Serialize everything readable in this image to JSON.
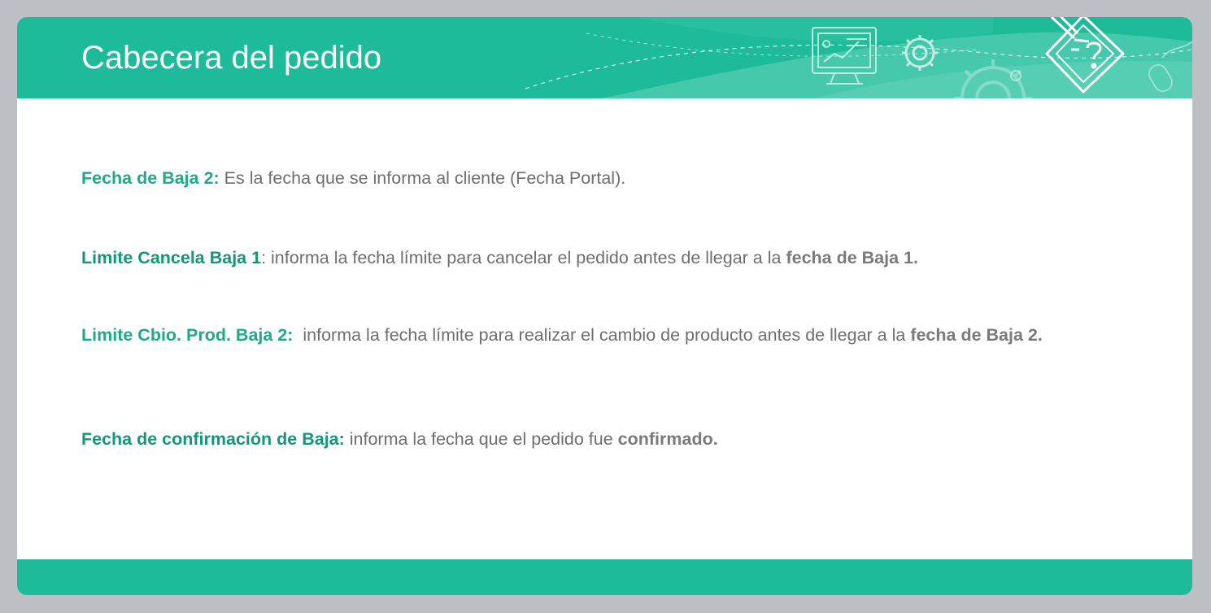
{
  "header": {
    "title": "Cabecera del pedido"
  },
  "icons": [
    "presentation-monitor-icon",
    "gear-icon",
    "large-gear-icon",
    "document-question-icon",
    "mouse-icon"
  ],
  "colors": {
    "accent": "#1dbb99",
    "label": "#1ea98a",
    "body_text": "#6e6e6e",
    "background": "#bcc0c4"
  },
  "content": {
    "item1": {
      "label": "Fecha de Baja 2:",
      "text": " Es la fecha que se informa al cliente (Fecha Portal)."
    },
    "item2": {
      "label": "Limite Cancela Baja 1",
      "text": ": informa la fecha límite para cancelar el pedido antes de llegar a la ",
      "strong": "fecha de Baja 1."
    },
    "item3": {
      "label": "Limite Cbio. Prod. Baja 2:",
      "text": "  informa la fecha límite para realizar el cambio de producto antes de llegar a la ",
      "strong": "fecha de Baja 2."
    },
    "item4": {
      "label": "Fecha de confirmación de Baja:",
      "text": " informa la fecha que el pedido fue ",
      "strong": "confirmado."
    }
  }
}
